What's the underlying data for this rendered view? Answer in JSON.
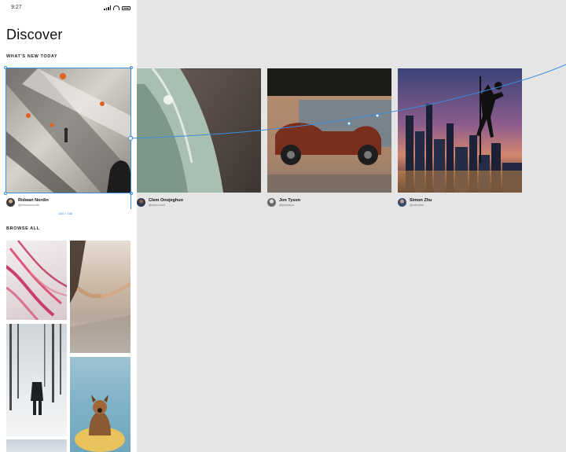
{
  "status_bar": {
    "time": "9:27"
  },
  "page": {
    "title": "Discover"
  },
  "sections": {
    "whats_new": "WHAT'S NEW TODAY",
    "browse_all": "BROWSE ALL"
  },
  "cards": [
    {
      "image": "escalator-photo",
      "author": "Ridwan Nordin",
      "handle": "@ridwannordin"
    },
    {
      "image": "car-photo",
      "author": "Clem Onojeghuo",
      "handle": "@clemono2"
    },
    {
      "image": "scooter-mural-photo",
      "author": "Jon Tyson",
      "handle": "@jontyson"
    },
    {
      "image": "city-climber-photo",
      "author": "Simon Zhu",
      "handle": "@smnzhu"
    }
  ],
  "selection": {
    "size_label": "158 × 158"
  },
  "browse_images": [
    "pink-feathers-photo",
    "holding-hands-photo",
    "snowy-forest-walk-photo",
    "dog-on-paddleboard-photo",
    "snow-trees-photo"
  ],
  "colors": {
    "selection": "#3a8de0",
    "canvas": "#e5e5e5"
  }
}
